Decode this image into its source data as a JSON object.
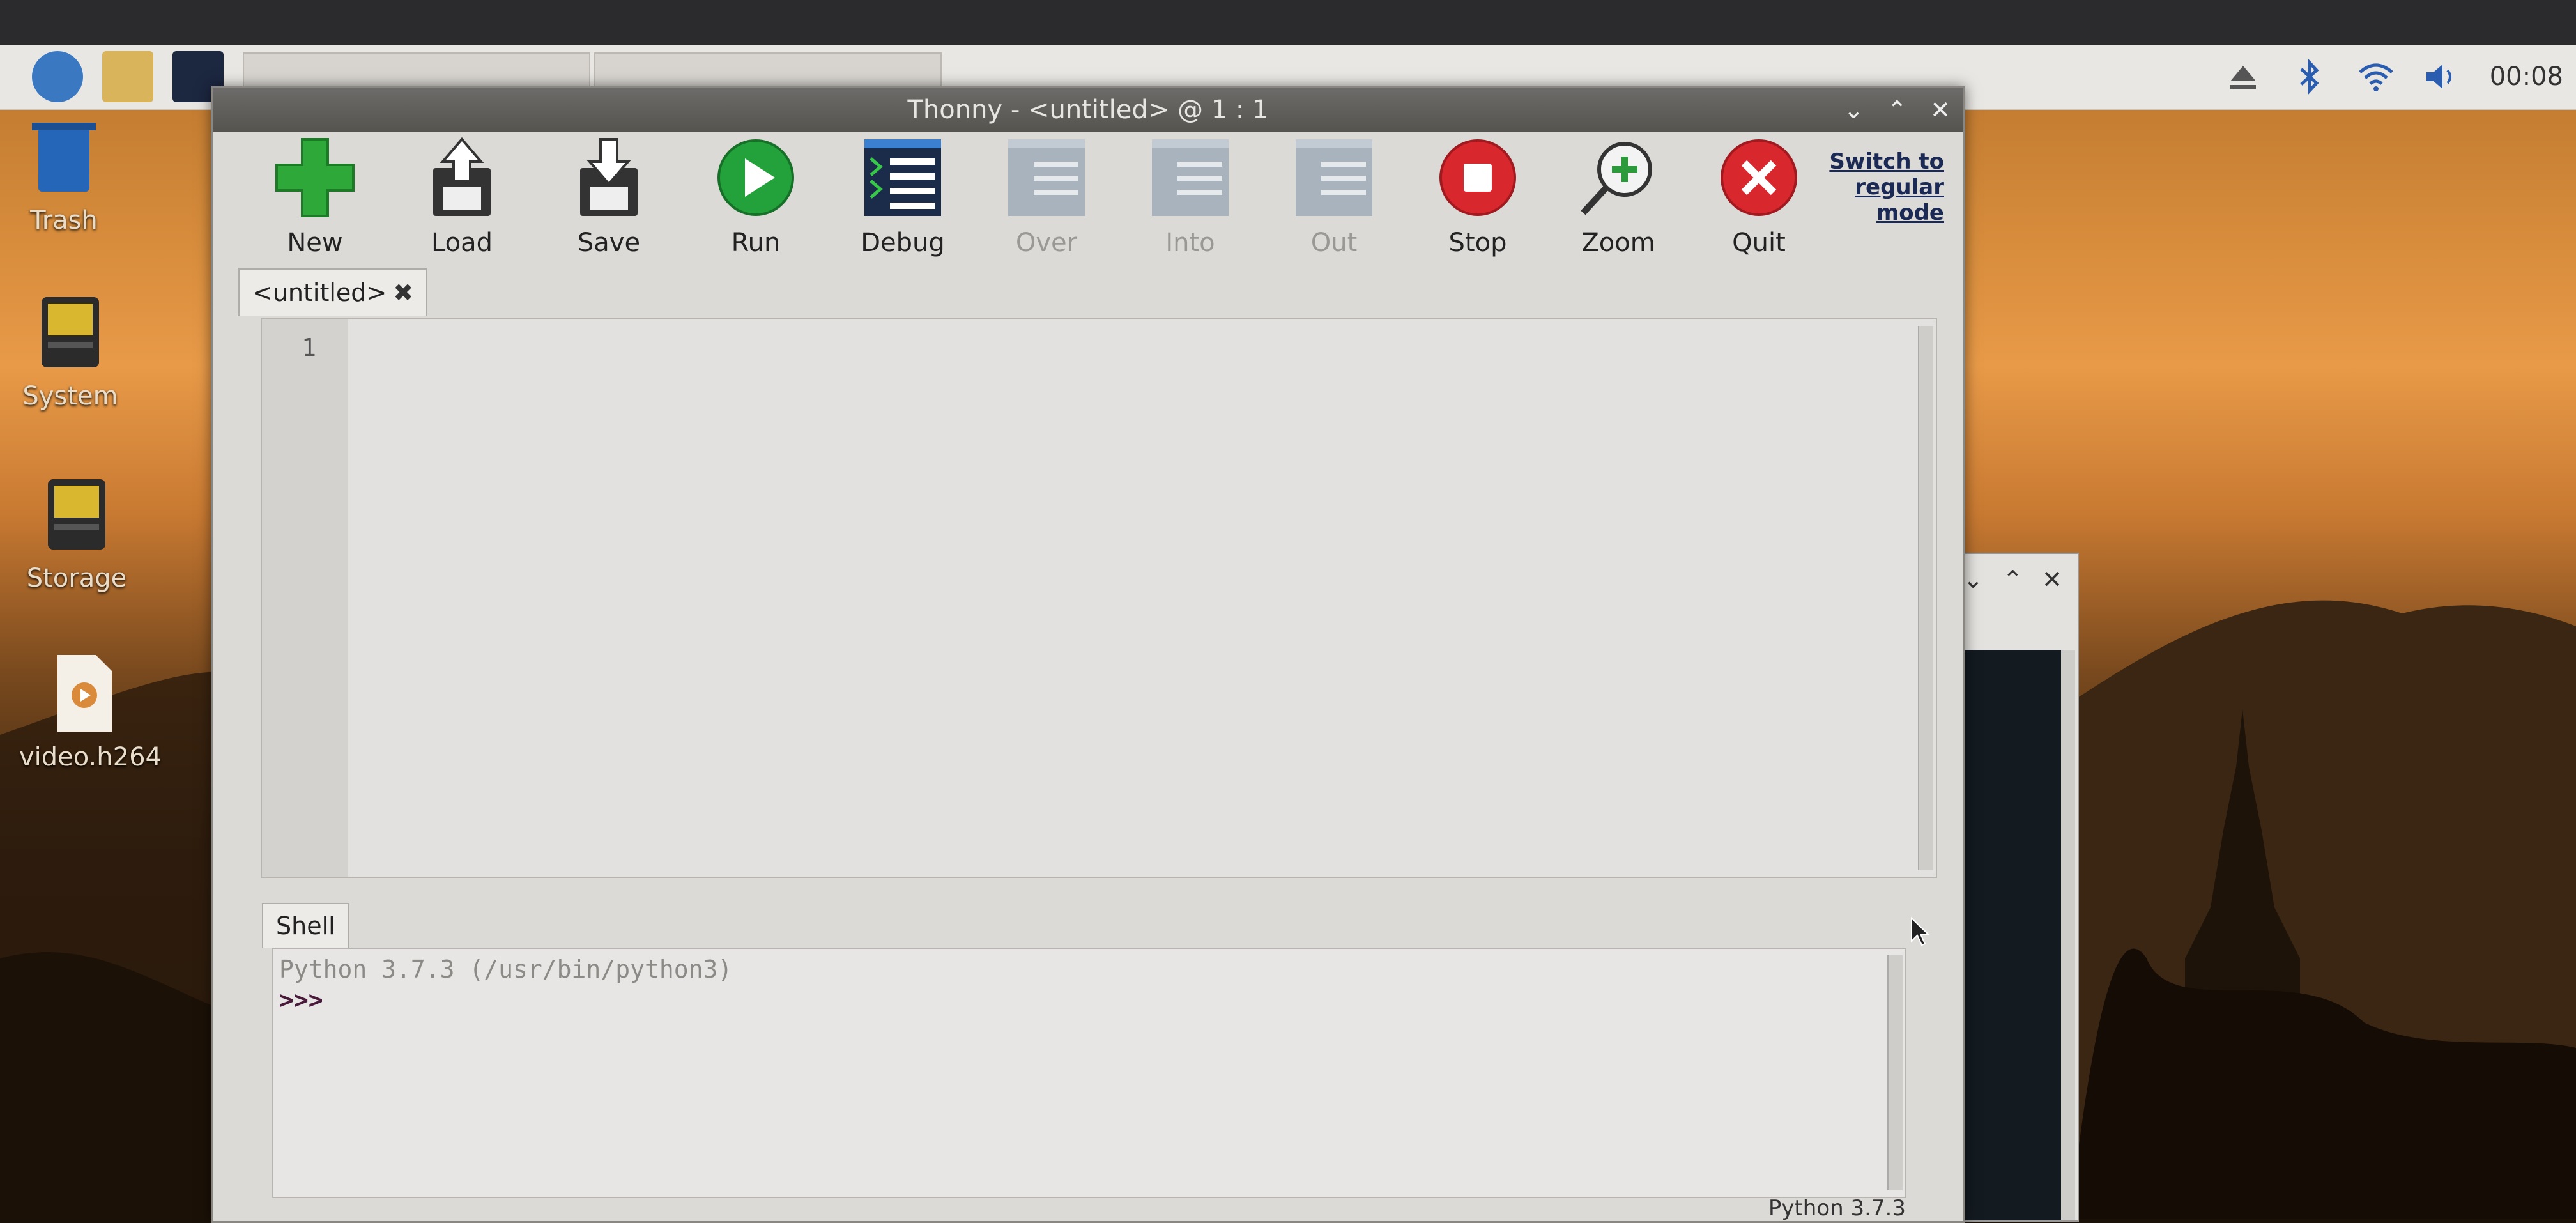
{
  "desktop": {
    "icons": [
      {
        "label": "Trash",
        "icon": "trash-icon"
      },
      {
        "label": "System",
        "icon": "drive-icon"
      },
      {
        "label": "Storage",
        "icon": "drive-icon"
      },
      {
        "label": "video.h264",
        "icon": "video-file-icon"
      }
    ]
  },
  "panel": {
    "clock": "00:08",
    "tray_icons": [
      "eject-icon",
      "bluetooth-icon",
      "wifi-icon",
      "volume-icon"
    ]
  },
  "thonny": {
    "title": "Thonny  -  <untitled>  @  1 : 1",
    "toolbar": [
      {
        "label": "New",
        "icon": "new-file-icon",
        "enabled": true
      },
      {
        "label": "Load",
        "icon": "load-icon",
        "enabled": true
      },
      {
        "label": "Save",
        "icon": "save-icon",
        "enabled": true
      },
      {
        "label": "Run",
        "icon": "run-icon",
        "enabled": true
      },
      {
        "label": "Debug",
        "icon": "debug-icon",
        "enabled": true
      },
      {
        "label": "Over",
        "icon": "step-over-icon",
        "enabled": false
      },
      {
        "label": "Into",
        "icon": "step-into-icon",
        "enabled": false
      },
      {
        "label": "Out",
        "icon": "step-out-icon",
        "enabled": false
      },
      {
        "label": "Stop",
        "icon": "stop-icon",
        "enabled": true
      },
      {
        "label": "Zoom",
        "icon": "zoom-icon",
        "enabled": true
      },
      {
        "label": "Quit",
        "icon": "quit-icon",
        "enabled": true
      }
    ],
    "switch_mode": "Switch to regular mode",
    "editor": {
      "tab_label": "<untitled>",
      "line_number": "1"
    },
    "shell": {
      "tab_label": "Shell",
      "banner": "Python 3.7.3 (/usr/bin/python3)",
      "prompt": ">>>"
    },
    "status": "Python 3.7.3"
  }
}
